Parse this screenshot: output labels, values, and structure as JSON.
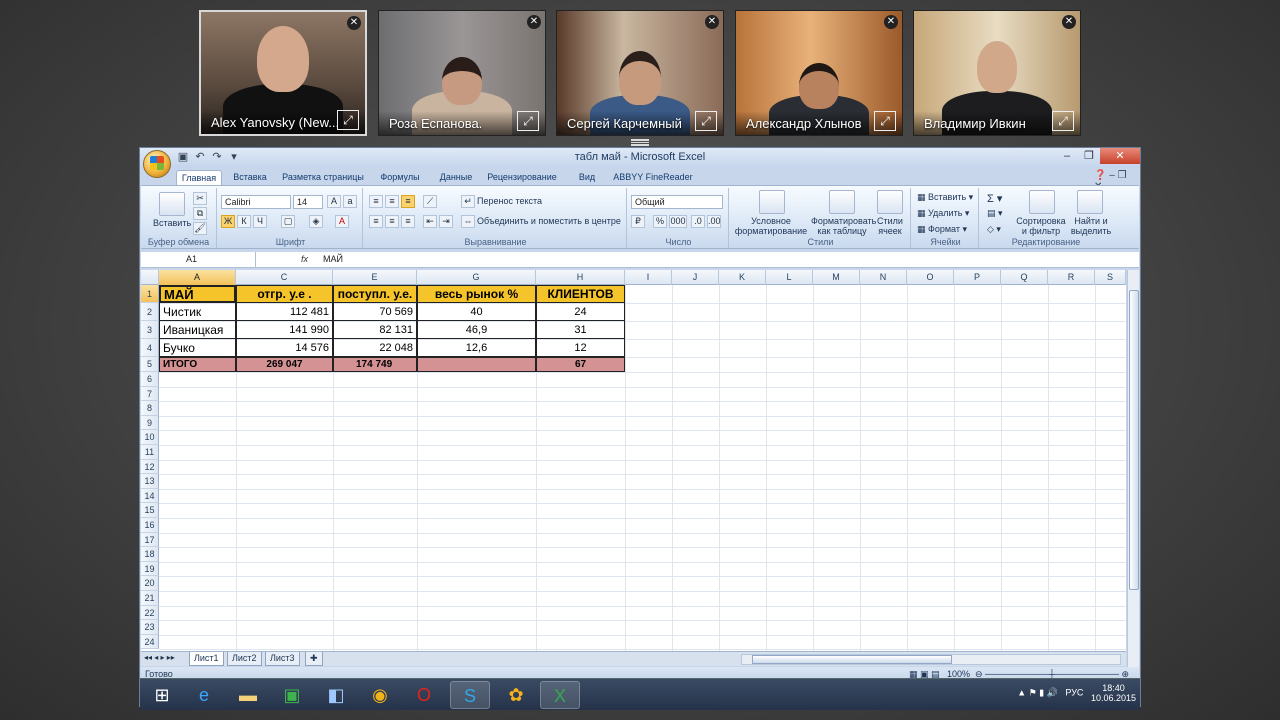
{
  "participants": [
    {
      "name": "Alex Yanovsky (New...",
      "active": true
    },
    {
      "name": "Роза Еспанова.",
      "active": false
    },
    {
      "name": "Сергей Карчемный",
      "active": false
    },
    {
      "name": "Александр Хлынов",
      "active": false
    },
    {
      "name": "Владимир Ивкин",
      "active": false
    }
  ],
  "window": {
    "title": "табл май - Microsoft Excel"
  },
  "tabs": [
    "Главная",
    "Вставка",
    "Разметка страницы",
    "Формулы",
    "Данные",
    "Рецензирование",
    "Вид",
    "ABBYY FineReader 11"
  ],
  "ribbon": {
    "clipboard": {
      "label": "Буфер обмена",
      "paste": "Вставить"
    },
    "font": {
      "label": "Шрифт",
      "family": "Calibri",
      "size": "14",
      "bold": "Ж",
      "italic": "К",
      "underline": "Ч"
    },
    "alignment": {
      "label": "Выравнивание",
      "wrap": "Перенос текста",
      "merge": "Объединить и поместить в центре"
    },
    "number": {
      "label": "Число",
      "format": "Общий",
      "percent": "%",
      "thousands": "000"
    },
    "styles": {
      "label": "Стили",
      "conditional": "Условное форматирование",
      "table": "Форматировать как таблицу",
      "cell_styles": "Стили ячеек"
    },
    "cells": {
      "label": "Ячейки",
      "insert": "Вставить",
      "delete": "Удалить",
      "format": "Формат"
    },
    "editing": {
      "label": "Редактирование",
      "sort": "Сортировка и фильтр",
      "find": "Найти и выделить"
    }
  },
  "formula_bar": {
    "name_box": "A1",
    "fx": "fx",
    "value": "МАЙ"
  },
  "columns": [
    "A",
    "C",
    "E",
    "G",
    "H",
    "I",
    "J",
    "K",
    "L",
    "M",
    "N",
    "O",
    "P",
    "Q",
    "R",
    "S"
  ],
  "rows": [
    "1",
    "2",
    "3",
    "4",
    "5",
    "6",
    "7",
    "8",
    "9",
    "10",
    "11",
    "12",
    "13",
    "14",
    "15",
    "16",
    "17",
    "18",
    "19",
    "20",
    "21",
    "22",
    "23",
    "24"
  ],
  "table": {
    "headers": [
      "МАЙ",
      "отгр. у.е .",
      "поступл. у.е.",
      "весь рынок %",
      "КЛИЕНТОВ"
    ],
    "body": [
      [
        "Чистик",
        "112 481",
        "70 569",
        "40",
        "24"
      ],
      [
        "Иваницкая",
        "141 990",
        "82 131",
        "46,9",
        "31"
      ],
      [
        "Бучко",
        "14 576",
        "22 048",
        "12,6",
        "12"
      ]
    ],
    "total": [
      "ИТОГО",
      "269 047",
      "174 749",
      "",
      "67"
    ]
  },
  "sheets": [
    "Лист1",
    "Лист2",
    "Лист3"
  ],
  "status": {
    "ready": "Готово",
    "zoom": "100%"
  },
  "tray": {
    "lang": "РУС",
    "time": "18:40",
    "date": "10.06.2015"
  }
}
